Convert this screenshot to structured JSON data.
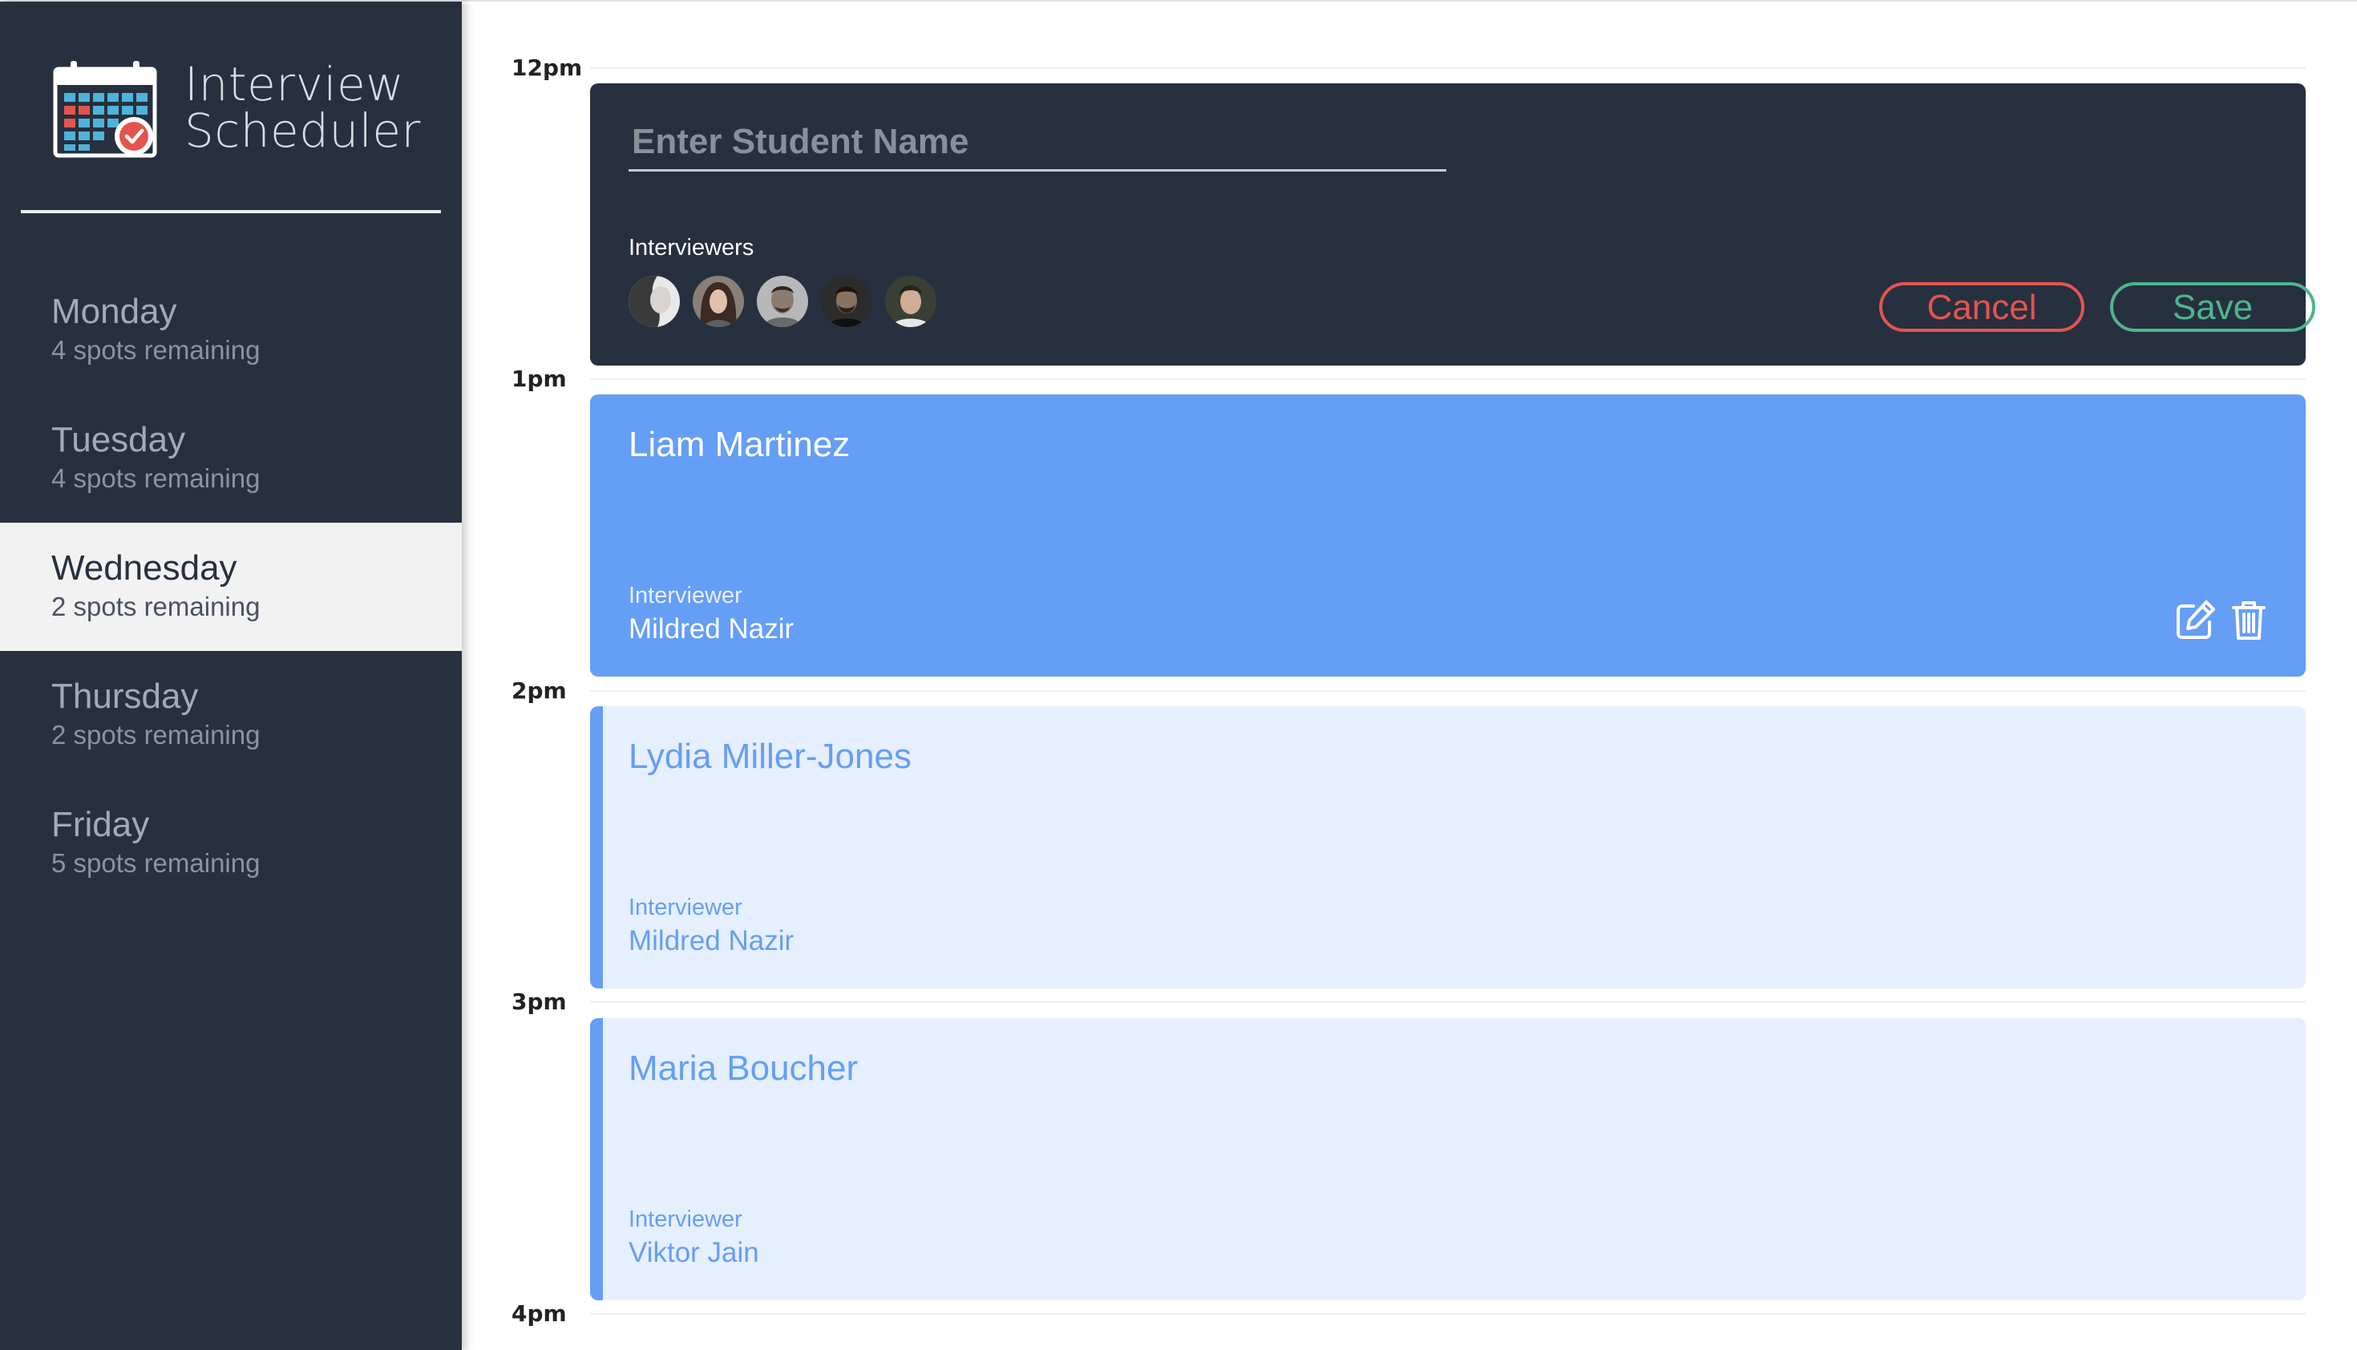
{
  "sidebar": {
    "brand_title_line1": "Interview",
    "brand_title_line2": "Scheduler",
    "logo_icon": "calendar-check-icon",
    "days": [
      {
        "name": "Monday",
        "spots": "4 spots remaining",
        "selected": false
      },
      {
        "name": "Tuesday",
        "spots": "4 spots remaining",
        "selected": false
      },
      {
        "name": "Wednesday",
        "spots": "2 spots remaining",
        "selected": true
      },
      {
        "name": "Thursday",
        "spots": "2 spots remaining",
        "selected": false
      },
      {
        "name": "Friday",
        "spots": "5 spots remaining",
        "selected": false
      }
    ]
  },
  "schedule": {
    "hours": [
      "12pm",
      "1pm",
      "2pm",
      "3pm",
      "4pm"
    ],
    "form": {
      "student_placeholder": "Enter Student Name",
      "student_value": "",
      "interviewers_label": "Interviewers",
      "interviewer_avatars": [
        "avatar-1",
        "avatar-2",
        "avatar-3",
        "avatar-4",
        "avatar-5"
      ],
      "cancel_label": "Cancel",
      "save_label": "Save"
    },
    "appointments": [
      {
        "student": "Liam Martinez",
        "interviewer_label": "Interviewer",
        "interviewer": "Mildred Nazir",
        "state": "active",
        "actions": [
          "edit-icon",
          "trash-icon"
        ]
      },
      {
        "student": "Lydia Miller-Jones",
        "interviewer_label": "Interviewer",
        "interviewer": "Mildred Nazir",
        "state": "booked"
      },
      {
        "student": "Maria Boucher",
        "interviewer_label": "Interviewer",
        "interviewer": "Viktor Jain",
        "state": "booked"
      }
    ]
  },
  "colors": {
    "sidebar_bg": "#27303f",
    "accent_blue": "#659ef5",
    "light_blue": "#e6effd",
    "cancel_red": "#e4544e",
    "save_green": "#4eb48c"
  }
}
